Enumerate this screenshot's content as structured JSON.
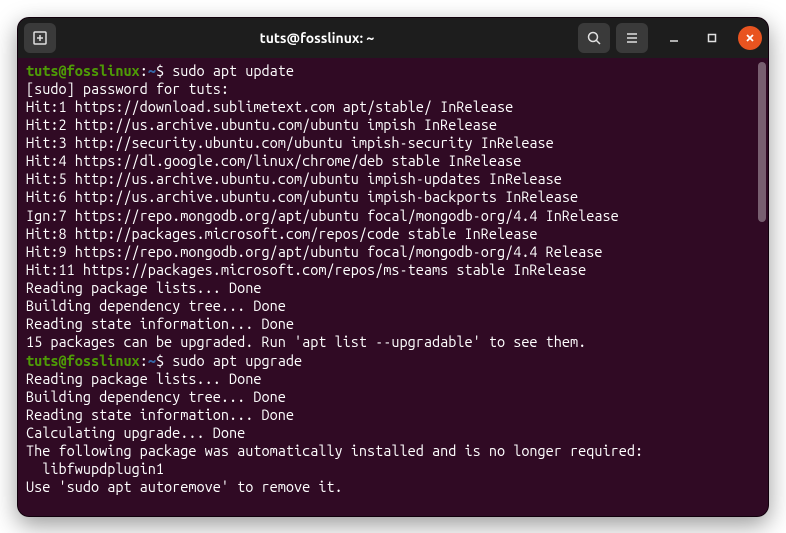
{
  "window": {
    "title": "tuts@fosslinux: ~"
  },
  "prompt": {
    "user_host": "tuts@fosslinux",
    "colon": ":",
    "path": "~",
    "dollar": "$ "
  },
  "commands": {
    "cmd1": "sudo apt update",
    "cmd2": "sudo apt upgrade"
  },
  "output": {
    "l1": "[sudo] password for tuts:",
    "l2": "Hit:1 https://download.sublimetext.com apt/stable/ InRelease",
    "l3": "Hit:2 http://us.archive.ubuntu.com/ubuntu impish InRelease",
    "l4": "Hit:3 http://security.ubuntu.com/ubuntu impish-security InRelease",
    "l5": "Hit:4 https://dl.google.com/linux/chrome/deb stable InRelease",
    "l6": "Hit:5 http://us.archive.ubuntu.com/ubuntu impish-updates InRelease",
    "l7": "Hit:6 http://us.archive.ubuntu.com/ubuntu impish-backports InRelease",
    "l8": "Ign:7 https://repo.mongodb.org/apt/ubuntu focal/mongodb-org/4.4 InRelease",
    "l9": "Hit:8 http://packages.microsoft.com/repos/code stable InRelease",
    "l10": "Hit:9 https://repo.mongodb.org/apt/ubuntu focal/mongodb-org/4.4 Release",
    "l11": "Hit:11 https://packages.microsoft.com/repos/ms-teams stable InRelease",
    "l12": "Reading package lists... Done",
    "l13": "Building dependency tree... Done",
    "l14": "Reading state information... Done",
    "l15": "15 packages can be upgraded. Run 'apt list --upgradable' to see them.",
    "l16": "Reading package lists... Done",
    "l17": "Building dependency tree... Done",
    "l18": "Reading state information... Done",
    "l19": "Calculating upgrade... Done",
    "l20": "The following package was automatically installed and is no longer required:",
    "l21": "  libfwupdplugin1",
    "l22": "Use 'sudo apt autoremove' to remove it."
  }
}
